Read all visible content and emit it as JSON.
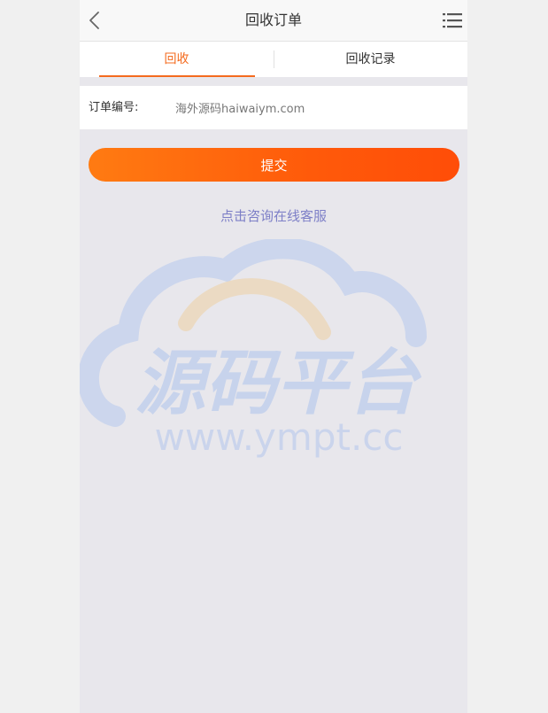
{
  "header": {
    "title": "回收订单",
    "back_icon": "chevron-left-icon",
    "menu_icon": "list-menu-icon"
  },
  "tabs": [
    {
      "label": "回收",
      "active": true
    },
    {
      "label": "回收记录",
      "active": false
    }
  ],
  "form": {
    "order_label": "订单编号:",
    "order_value": "海外源码haiwaiym.com"
  },
  "submit": {
    "label": "提交"
  },
  "service_link": {
    "label": "点击咨询在线客服"
  },
  "watermark": {
    "title": "源码平台",
    "url": "www.ympt.cc"
  },
  "colors": {
    "accent": "#f46b1f",
    "button_start": "#ff7b12",
    "button_end": "#ff4d08",
    "link": "#7d7fc7",
    "page_bg": "#e8e7ec"
  }
}
